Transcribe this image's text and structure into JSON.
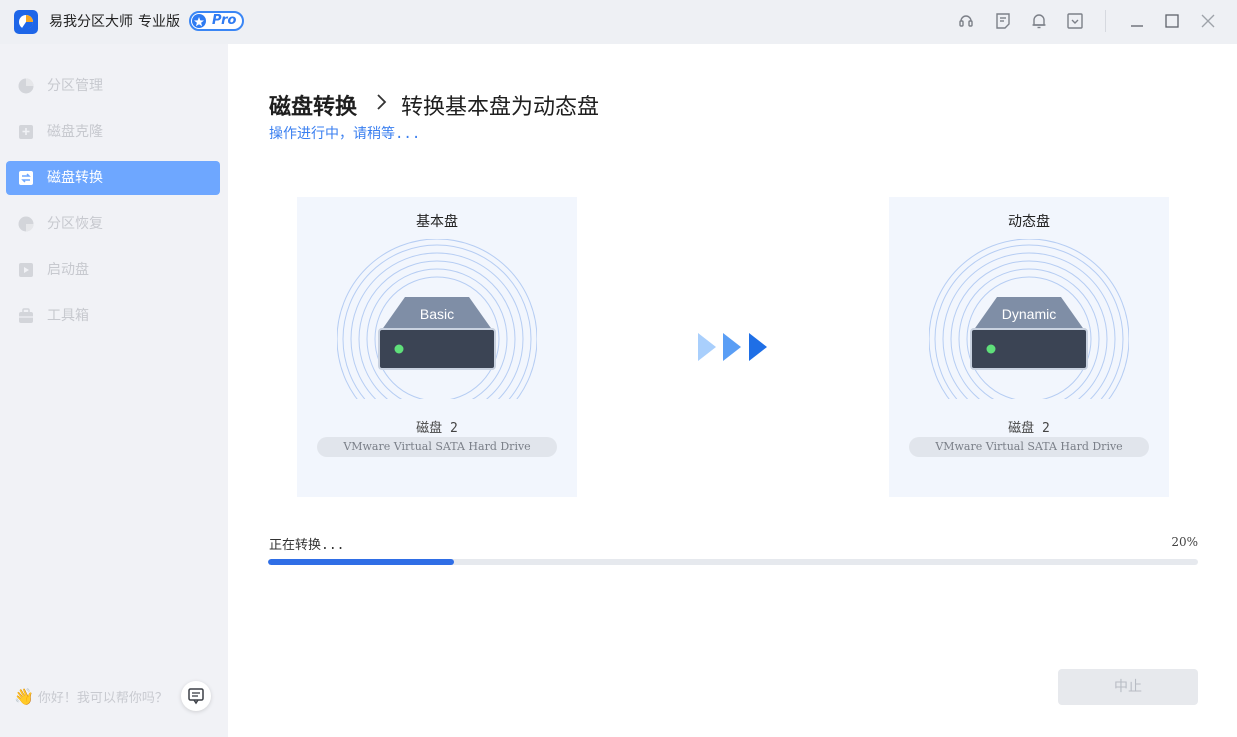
{
  "titlebar": {
    "app_title": "易我分区大师",
    "edition": "专业版",
    "badge": "Pro",
    "icons": [
      "support-icon",
      "feedback-icon",
      "notification-icon",
      "menu-dropdown-icon",
      "minimize-icon",
      "maximize-icon",
      "close-icon"
    ]
  },
  "sidebar": {
    "items": [
      {
        "label": "分区管理",
        "icon": "pie-chart-icon",
        "active": false
      },
      {
        "label": "磁盘克隆",
        "icon": "clone-icon",
        "active": false
      },
      {
        "label": "磁盘转换",
        "icon": "convert-icon",
        "active": true
      },
      {
        "label": "分区恢复",
        "icon": "recovery-icon",
        "active": false
      },
      {
        "label": "启动盘",
        "icon": "boot-disk-icon",
        "active": false
      },
      {
        "label": "工具箱",
        "icon": "toolbox-icon",
        "active": false
      }
    ],
    "chat_hint": "你好！我可以帮你吗？"
  },
  "main": {
    "breadcrumb_main": "磁盘转换",
    "breadcrumb_sub": "转换基本盘为动态盘",
    "status": "操作进行中，请稍等...",
    "source": {
      "title": "基本盘",
      "disk_label": "Basic",
      "disk_name": "磁盘 2",
      "model": "VMware Virtual SATA Hard Drive"
    },
    "target": {
      "title": "动态盘",
      "disk_label": "Dynamic",
      "disk_name": "磁盘 2",
      "model": "VMware Virtual SATA Hard Drive"
    },
    "progress": {
      "label": "正在转换...",
      "percent_text": "20%",
      "value": 0.2
    },
    "stop_button": "中止"
  },
  "colors": {
    "accent": "#2f6ee6",
    "sidebar_active": "#6ea7ff",
    "status_text": "#3a7ff0",
    "card_bg": "#f2f6fd"
  }
}
